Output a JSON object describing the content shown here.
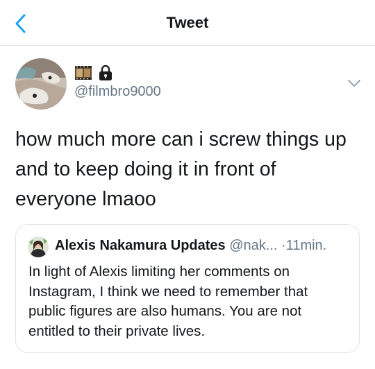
{
  "header": {
    "title": "Tweet"
  },
  "tweet": {
    "name_emojis": [
      "film-frames-emoji",
      "lock-emoji"
    ],
    "handle": "@filmbro9000",
    "text_lines": [
      "how much more can i screw things up",
      "and to keep doing it in front of",
      "everyone lmaoo"
    ]
  },
  "quoted_tweet": {
    "display_name": "Alexis Nakamura Updates",
    "handle": "@nak...",
    "separator": "·",
    "time": "11min.",
    "text_lines": [
      "In light of Alexis limiting her comments on",
      "Instagram, I think we need to remember that",
      "public figures are also humans. You are not",
      "entitled to their private lives."
    ]
  },
  "colors": {
    "accent": "#1da1f2",
    "text_primary": "#14171a",
    "text_secondary": "#657786",
    "border": "#dfe3e6",
    "background": "#ffffff"
  },
  "icons": {
    "back": "chevron-left-icon",
    "more": "chevron-down-icon"
  }
}
